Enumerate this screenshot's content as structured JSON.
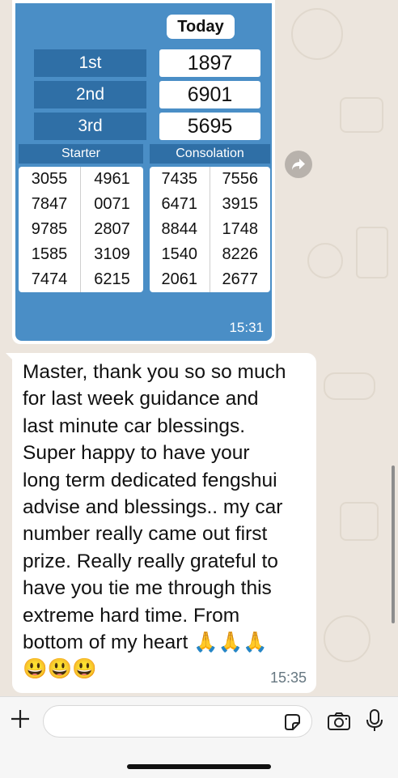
{
  "result_image": {
    "today_label": "Today",
    "prizes": [
      {
        "label": "1st",
        "value": "1897"
      },
      {
        "label": "2nd",
        "value": "6901"
      },
      {
        "label": "3rd",
        "value": "5695"
      }
    ],
    "starter_label": "Starter",
    "consolation_label": "Consolation",
    "starter_rows": [
      [
        "3055",
        "4961"
      ],
      [
        "7847",
        "0071"
      ],
      [
        "9785",
        "2807"
      ],
      [
        "1585",
        "3109"
      ],
      [
        "7474",
        "6215"
      ]
    ],
    "consolation_rows": [
      [
        "7435",
        "7556"
      ],
      [
        "6471",
        "3915"
      ],
      [
        "8844",
        "1748"
      ],
      [
        "1540",
        "8226"
      ],
      [
        "2061",
        "2677"
      ]
    ],
    "time": "15:31"
  },
  "message": {
    "text": "Master, thank you so so much\nfor last week guidance and\nlast minute car blessings.\nSuper happy to have your\nlong term dedicated fengshui\nadvise and blessings.. my car\nnumber really came out first\nprize. Really really grateful to\nhave you tie me through this\nextreme hard time. From\nbottom of my heart 🙏🙏🙏\n😃😃😃",
    "time": "15:35"
  },
  "icons": {
    "forward": "forward-icon",
    "plus": "plus-icon",
    "sticker": "sticker-icon",
    "camera": "camera-icon",
    "mic": "microphone-icon"
  },
  "colors": {
    "chat_bg": "#ece5dd",
    "image_blue": "#4a8ec6",
    "label_blue": "#2f6fa6",
    "bubble": "#ffffff",
    "timestamp": "#667781"
  }
}
